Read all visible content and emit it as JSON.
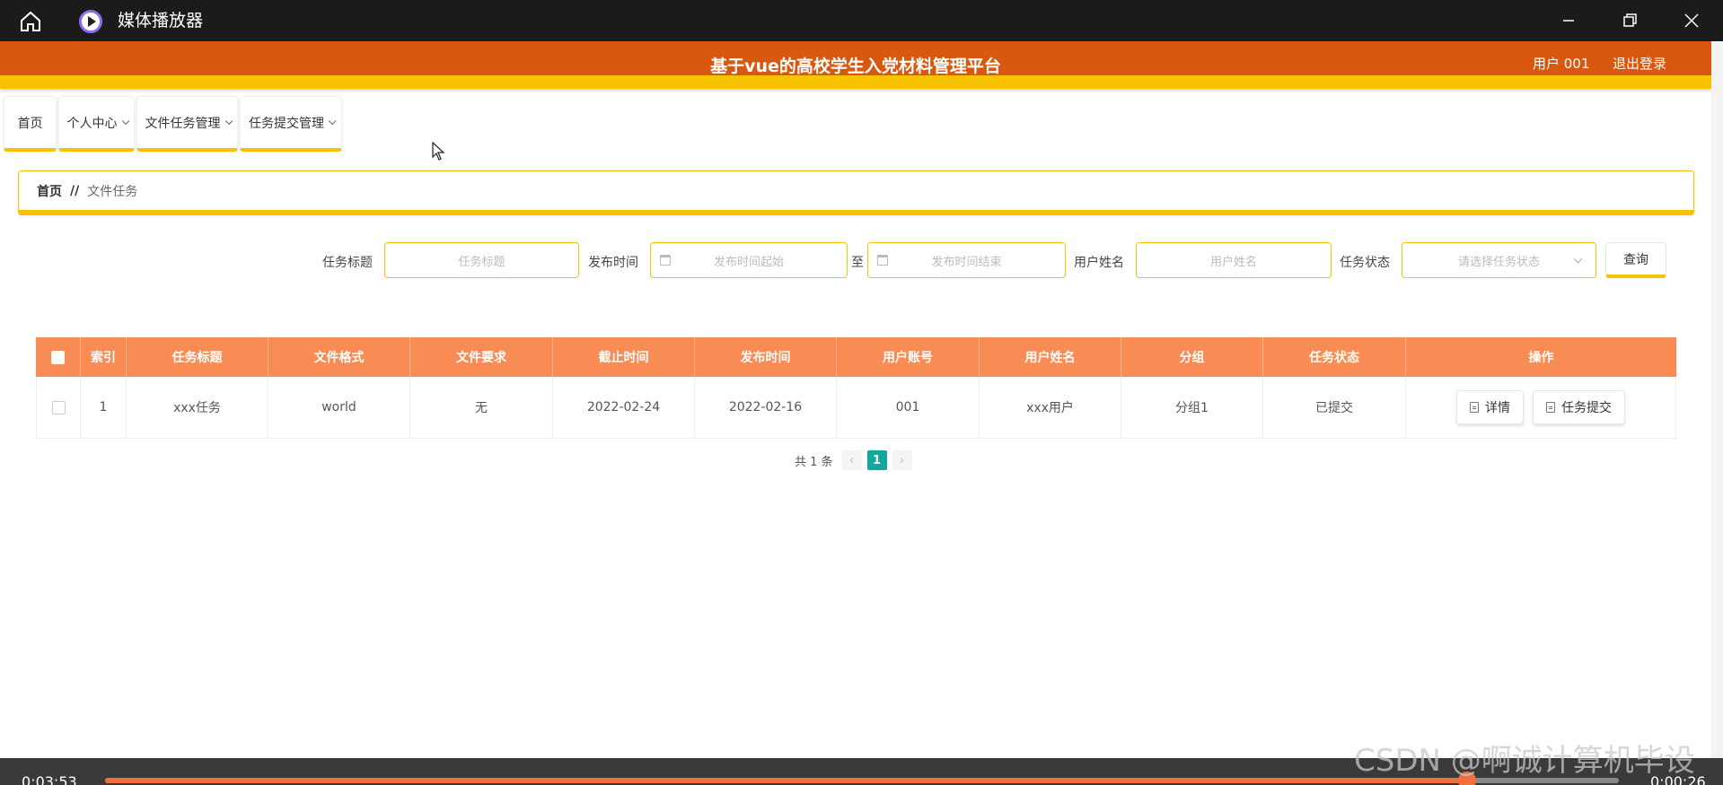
{
  "window": {
    "app_title": "媒体播放器",
    "icons": [
      "home-icon",
      "media-player-icon",
      "minimize-icon",
      "maximize-icon",
      "close-icon"
    ]
  },
  "header": {
    "platform_title": "基于vue的高校学生入党材料管理平台",
    "user_label": "用户 001",
    "logout_label": "退出登录",
    "accent_color": "#d9580f",
    "stripe_color": "#f7c300"
  },
  "nav": {
    "items": [
      {
        "label": "首页",
        "has_dropdown": false
      },
      {
        "label": "个人中心",
        "has_dropdown": true
      },
      {
        "label": "文件任务管理",
        "has_dropdown": true
      },
      {
        "label": "任务提交管理",
        "has_dropdown": true
      }
    ]
  },
  "breadcrumb": {
    "home": "首页",
    "separator": "//",
    "current": "文件任务"
  },
  "search": {
    "title_label": "任务标题",
    "title_placeholder": "任务标题",
    "time_label": "发布时间",
    "time_start_placeholder": "发布时间起始",
    "to_label": "至",
    "time_end_placeholder": "发布时间结束",
    "username_label": "用户姓名",
    "username_placeholder": "用户姓名",
    "status_label": "任务状态",
    "status_placeholder": "请选择任务状态",
    "query_label": "查询"
  },
  "table": {
    "header_color": "#f98c54",
    "columns": [
      "索引",
      "任务标题",
      "文件格式",
      "文件要求",
      "截止时间",
      "发布时间",
      "用户账号",
      "用户姓名",
      "分组",
      "任务状态",
      "操作"
    ],
    "rows": [
      {
        "index": "1",
        "title": "xxx任务",
        "format": "world",
        "requirement": "无",
        "deadline": "2022-02-24",
        "publish_time": "2022-02-16",
        "account": "001",
        "username": "xxx用户",
        "group": "分组1",
        "status": "已提交",
        "actions": [
          "详情",
          "任务提交"
        ]
      }
    ]
  },
  "pagination": {
    "total_text": "共 1 条",
    "prev": "‹",
    "current_page": "1",
    "next": "›",
    "active_color": "#13a89e"
  },
  "player": {
    "current_time": "0:03:53",
    "remaining_time": "0:00:26",
    "progress": 0.9
  },
  "watermark": "CSDN @啊诚计算机毕设"
}
